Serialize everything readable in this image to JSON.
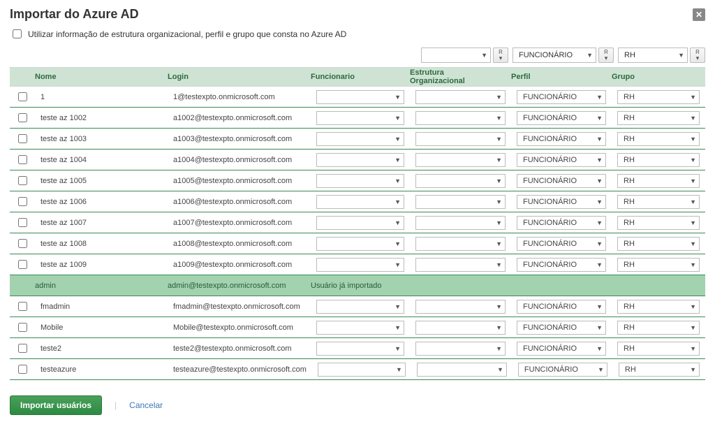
{
  "dialog": {
    "title": "Importar do Azure AD",
    "use_azure_info_label": "Utilizar informação de estrutura organizacional, perfil e grupo que consta no Azure AD"
  },
  "top_filters": {
    "funcionario": {
      "value": ""
    },
    "estrutura": {
      "apply_label": "R"
    },
    "perfil": {
      "value": "FUNCIONÁRIO",
      "apply_label": "R"
    },
    "grupo": {
      "value": "RH",
      "apply_label": "R"
    }
  },
  "columns": {
    "nome": "Nome",
    "login": "Login",
    "funcionario": "Funcionario",
    "estrutura": "Estrutura Organizacional",
    "perfil": "Perfil",
    "grupo": "Grupo"
  },
  "already_imported_text": "Usuário já importado",
  "rows": [
    {
      "nome": "1",
      "login": "1@testexpto.onmicrosoft.com",
      "func": "",
      "estr": "",
      "perfil": "FUNCIONÁRIO",
      "grupo": "RH",
      "imported": false
    },
    {
      "nome": "teste az 1002",
      "login": "a1002@testexpto.onmicrosoft.com",
      "func": "",
      "estr": "",
      "perfil": "FUNCIONÁRIO",
      "grupo": "RH",
      "imported": false
    },
    {
      "nome": "teste az 1003",
      "login": "a1003@testexpto.onmicrosoft.com",
      "func": "",
      "estr": "",
      "perfil": "FUNCIONÁRIO",
      "grupo": "RH",
      "imported": false
    },
    {
      "nome": "teste az 1004",
      "login": "a1004@testexpto.onmicrosoft.com",
      "func": "",
      "estr": "",
      "perfil": "FUNCIONÁRIO",
      "grupo": "RH",
      "imported": false
    },
    {
      "nome": "teste az 1005",
      "login": "a1005@testexpto.onmicrosoft.com",
      "func": "",
      "estr": "",
      "perfil": "FUNCIONÁRIO",
      "grupo": "RH",
      "imported": false
    },
    {
      "nome": "teste az 1006",
      "login": "a1006@testexpto.onmicrosoft.com",
      "func": "",
      "estr": "",
      "perfil": "FUNCIONÁRIO",
      "grupo": "RH",
      "imported": false
    },
    {
      "nome": "teste az 1007",
      "login": "a1007@testexpto.onmicrosoft.com",
      "func": "",
      "estr": "",
      "perfil": "FUNCIONÁRIO",
      "grupo": "RH",
      "imported": false
    },
    {
      "nome": "teste az 1008",
      "login": "a1008@testexpto.onmicrosoft.com",
      "func": "",
      "estr": "",
      "perfil": "FUNCIONÁRIO",
      "grupo": "RH",
      "imported": false
    },
    {
      "nome": "teste az 1009",
      "login": "a1009@testexpto.onmicrosoft.com",
      "func": "",
      "estr": "",
      "perfil": "FUNCIONÁRIO",
      "grupo": "RH",
      "imported": false
    },
    {
      "nome": "admin",
      "login": "admin@testexpto.onmicrosoft.com",
      "func": "",
      "estr": "",
      "perfil": "",
      "grupo": "",
      "imported": true
    },
    {
      "nome": "fmadmin",
      "login": "fmadmin@testexpto.onmicrosoft.com",
      "func": "",
      "estr": "",
      "perfil": "FUNCIONÁRIO",
      "grupo": "RH",
      "imported": false
    },
    {
      "nome": "Mobile",
      "login": "Mobile@testexpto.onmicrosoft.com",
      "func": "",
      "estr": "",
      "perfil": "FUNCIONÁRIO",
      "grupo": "RH",
      "imported": false
    },
    {
      "nome": "teste2",
      "login": "teste2@testexpto.onmicrosoft.com",
      "func": "",
      "estr": "",
      "perfil": "FUNCIONÁRIO",
      "grupo": "RH",
      "imported": false
    },
    {
      "nome": "testeazure",
      "login": "testeazure@testexpto.onmicrosoft.com",
      "func": "",
      "estr": "",
      "perfil": "FUNCIONÁRIO",
      "grupo": "RH",
      "imported": false
    }
  ],
  "footer": {
    "import_btn": "Importar usuários",
    "cancel": "Cancelar"
  }
}
